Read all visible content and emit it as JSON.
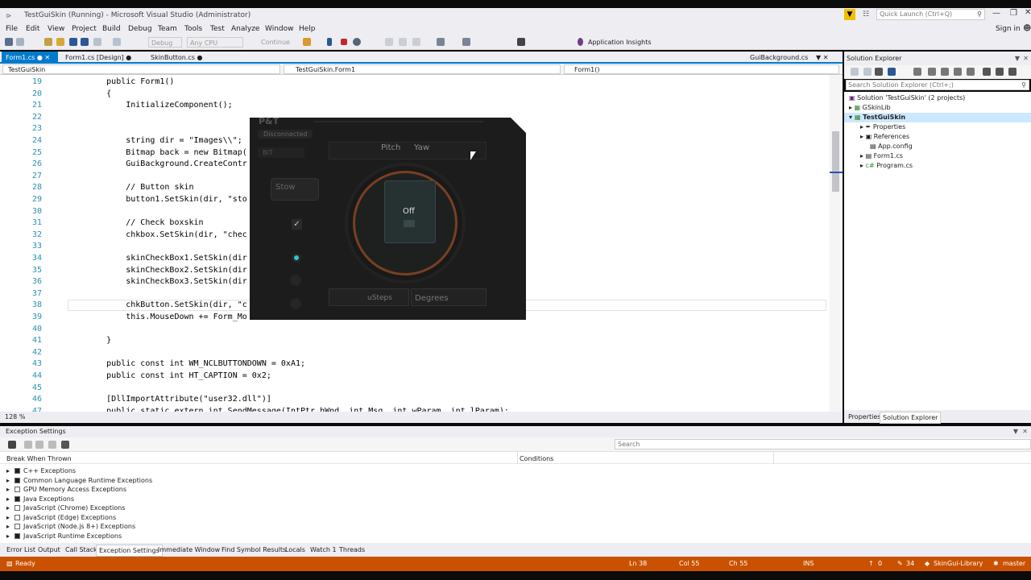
{
  "window": {
    "title": "TestGuiSkin (Running) - Microsoft Visual Studio  (Administrator)",
    "quick_launch": "Quick Launch (Ctrl+Q)",
    "sign_in": "Sign in"
  },
  "menu": [
    "File",
    "Edit",
    "View",
    "Project",
    "Build",
    "Debug",
    "Team",
    "Tools",
    "Test",
    "Analyze",
    "Window",
    "Help"
  ],
  "toolbar": {
    "config": "Debug",
    "platform": "Any CPU",
    "continue": "Continue",
    "insights": "Application Insights"
  },
  "tabs": [
    {
      "label": "Form1.cs"
    },
    {
      "label": "Form1.cs [Design]"
    },
    {
      "label": "SkinButton.cs"
    },
    {
      "label": "GuiBackground.cs"
    }
  ],
  "nav": {
    "project": "TestGuiSkin",
    "class": "TestGuiSkin.Form1",
    "member": "Form1()"
  },
  "code_lines": [
    {
      "n": "19",
      "t": "        public Form1()"
    },
    {
      "n": "20",
      "t": "        {"
    },
    {
      "n": "21",
      "t": "            InitializeComponent();"
    },
    {
      "n": "22",
      "t": ""
    },
    {
      "n": "23",
      "t": ""
    },
    {
      "n": "24",
      "t": "            string dir = \"Images\\\\\";"
    },
    {
      "n": "25",
      "t": "            Bitmap back = new Bitmap("
    },
    {
      "n": "26",
      "t": "            GuiBackground.CreateContr"
    },
    {
      "n": "27",
      "t": ""
    },
    {
      "n": "28",
      "t": "            // Button skin"
    },
    {
      "n": "29",
      "t": "            button1.SetSkin(dir, \"sto"
    },
    {
      "n": "30",
      "t": ""
    },
    {
      "n": "31",
      "t": "            // Check boxskin"
    },
    {
      "n": "32",
      "t": "            chkbox.SetSkin(dir, \"chec"
    },
    {
      "n": "33",
      "t": ""
    },
    {
      "n": "34",
      "t": "            skinCheckBox1.SetSkin(dir"
    },
    {
      "n": "35",
      "t": "            skinCheckBox2.SetSkin(dir"
    },
    {
      "n": "36",
      "t": "            skinCheckBox3.SetSkin(dir"
    },
    {
      "n": "37",
      "t": ""
    },
    {
      "n": "38",
      "t": "            chkButton.SetSkin(dir, \"c"
    },
    {
      "n": "39",
      "t": "            this.MouseDown += Form_Mo"
    },
    {
      "n": "40",
      "t": ""
    },
    {
      "n": "41",
      "t": "        }"
    },
    {
      "n": "42",
      "t": ""
    },
    {
      "n": "43",
      "t": "        public const int WM_NCLBUTTONDOWN = 0xA1;"
    },
    {
      "n": "44",
      "t": "        public const int HT_CAPTION = 0x2;"
    },
    {
      "n": "45",
      "t": ""
    },
    {
      "n": "46",
      "t": "        [DllImportAttribute(\"user32.dll\")]"
    },
    {
      "n": "47",
      "t": "        public static extern int SendMessage(IntPtr hWnd, int Msg, int wParam, int lParam);"
    }
  ],
  "zoom": "128 %",
  "solution_explorer": {
    "title": "Solution Explorer",
    "search_placeholder": "Search Solution Explorer (Ctrl+;)",
    "items": [
      {
        "label": "Solution 'TestGuiSkin' (2 projects)"
      },
      {
        "label": "GSkinLib"
      },
      {
        "label": "TestGuiSkin"
      },
      {
        "label": "Properties"
      },
      {
        "label": "References"
      },
      {
        "label": "App.config"
      },
      {
        "label": "Form1.cs"
      },
      {
        "label": "Program.cs"
      }
    ],
    "tabs": [
      "Properties",
      "Solution Explorer"
    ]
  },
  "skin_form": {
    "logo": "P&T",
    "status": "Disconnected",
    "bit": "BIT",
    "stow": "Stow",
    "pitch": "Pitch",
    "yaw": "Yaw",
    "center": "Off",
    "usteps": "uSteps",
    "degrees": "Degrees",
    "accent": "#2ec4d4"
  },
  "exception_settings": {
    "title": "Exception Settings",
    "search_placeholder": "Search",
    "col_break": "Break When Thrown",
    "col_conditions": "Conditions",
    "rows": [
      {
        "label": "C++ Exceptions",
        "checked": true
      },
      {
        "label": "Common Language Runtime Exceptions",
        "checked": true
      },
      {
        "label": "GPU Memory Access Exceptions",
        "checked": false
      },
      {
        "label": "Java Exceptions",
        "checked": true
      },
      {
        "label": "JavaScript (Chrome) Exceptions",
        "checked": false
      },
      {
        "label": "JavaScript (Edge) Exceptions",
        "checked": false
      },
      {
        "label": "JavaScript (Node.js 8+) Exceptions",
        "checked": false
      },
      {
        "label": "JavaScript Runtime Exceptions",
        "checked": true
      }
    ]
  },
  "bottom_tabs": [
    "Error List",
    "Output",
    "Call Stack",
    "Exception Settings",
    "Immediate Window",
    "Find Symbol Results",
    "Locals",
    "Watch 1",
    "Threads"
  ],
  "status": {
    "ready": "Ready",
    "ln": "Ln 38",
    "col": "Col 55",
    "ch": "Ch 55",
    "ins": "INS",
    "errors": "0",
    "changes": "34",
    "repo": "SkinGui-Library",
    "branch": "master"
  }
}
